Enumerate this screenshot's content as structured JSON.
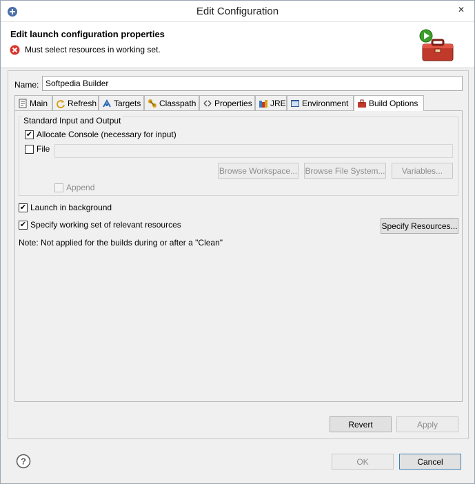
{
  "window": {
    "title": "Edit Configuration",
    "close_glyph": "✕"
  },
  "header": {
    "heading": "Edit launch configuration properties",
    "error_message": "Must select resources in working set.",
    "banner_icon": "toolbox-run-icon"
  },
  "name": {
    "label": "Name:",
    "value": "Softpedia Builder"
  },
  "tabs": [
    {
      "label": "Main",
      "icon": "main-tab-icon"
    },
    {
      "label": "Refresh",
      "icon": "refresh-tab-icon"
    },
    {
      "label": "Targets",
      "icon": "targets-tab-icon"
    },
    {
      "label": "Classpath",
      "icon": "classpath-tab-icon"
    },
    {
      "label": "Properties",
      "icon": "properties-tab-icon"
    },
    {
      "label": "JRE",
      "icon": "jre-tab-icon"
    },
    {
      "label": "Environment",
      "icon": "environment-tab-icon"
    },
    {
      "label": "Build Options",
      "icon": "build-options-tab-icon",
      "active": true
    }
  ],
  "build_options": {
    "group_title": "Standard Input and Output",
    "allocate_console": {
      "label": "Allocate Console (necessary for input)",
      "checked": true
    },
    "file": {
      "label": "File",
      "checked": false,
      "value": ""
    },
    "browse_workspace": "Browse Workspace...",
    "browse_file_system": "Browse File System...",
    "variables": "Variables...",
    "append": {
      "label": "Append",
      "checked": false,
      "enabled": false
    },
    "launch_background": {
      "label": "Launch in background",
      "checked": true
    },
    "working_set": {
      "label": "Specify working set of relevant resources",
      "checked": true
    },
    "specify_resources": "Specify Resources...",
    "note": "Note: Not applied for the builds during or after a \"Clean\""
  },
  "actions": {
    "revert": "Revert",
    "apply": "Apply",
    "ok": "OK",
    "cancel": "Cancel"
  },
  "colors": {
    "error": "#d9332b",
    "accent": "#3c9f2a",
    "toolbox": "#c0392b"
  }
}
